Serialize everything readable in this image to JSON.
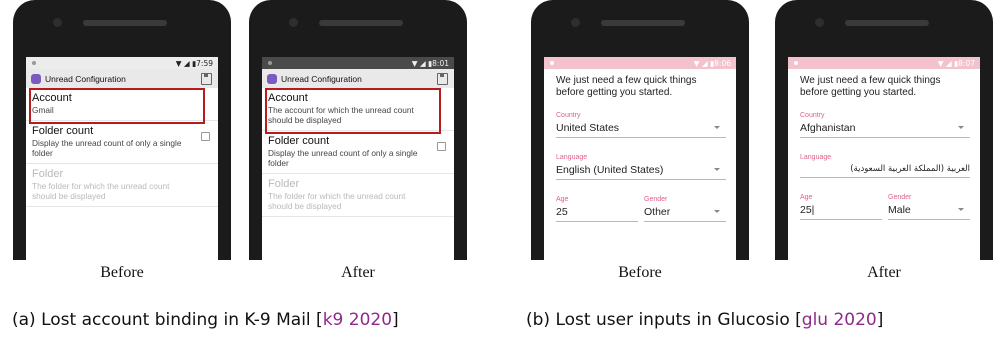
{
  "phones": [
    {
      "id": "k9-before",
      "status_time": "7:59",
      "app_title": "Unread Configuration",
      "items": [
        {
          "title": "Account",
          "subtitle": "Gmail",
          "disabled": false,
          "checkbox": false
        },
        {
          "title": "Folder count",
          "subtitle": "Display the unread count of only a single folder",
          "disabled": false,
          "checkbox": true
        },
        {
          "title": "Folder",
          "subtitle": "The folder for which the unread count should be displayed",
          "disabled": true,
          "checkbox": false
        }
      ],
      "caption": "Before"
    },
    {
      "id": "k9-after",
      "status_time": "8:01",
      "app_title": "Unread Configuration",
      "items": [
        {
          "title": "Account",
          "subtitle": "The account for which the unread count should be displayed",
          "disabled": false,
          "checkbox": false
        },
        {
          "title": "Folder count",
          "subtitle": "Display the unread count of only a single folder",
          "disabled": false,
          "checkbox": true
        },
        {
          "title": "Folder",
          "subtitle": "The folder for which the unread count should be displayed",
          "disabled": true,
          "checkbox": false
        }
      ],
      "caption": "After"
    },
    {
      "id": "glucosio-before",
      "status_time": "8:06",
      "intro": "We just need a few quick things before getting you started.",
      "country_label": "Country",
      "country_value": "United States",
      "language_label": "Language",
      "language_value": "English (United States)",
      "age_label": "Age",
      "age_value": "25",
      "gender_label": "Gender",
      "gender_value": "Other",
      "caption": "Before"
    },
    {
      "id": "glucosio-after",
      "status_time": "8:07",
      "intro": "We just need a few quick things before getting you started.",
      "country_label": "Country",
      "country_value": "Afghanistan",
      "language_label": "Language",
      "language_value": "العربية (المملكة العربية السعودية)",
      "age_label": "Age",
      "age_value": "25|",
      "gender_label": "Gender",
      "gender_value": "Male",
      "caption": "After"
    }
  ],
  "subcaptions": {
    "a_text": "(a) Lost account binding in K-9 Mail [",
    "a_cite": "k9 2020",
    "a_close": "]",
    "b_text": "(b) Lost user inputs in Glucosio [",
    "b_cite": "glu 2020",
    "b_close": "]"
  },
  "colors": {
    "highlight_box": "#b71c1c",
    "citation": "#8e2a8a",
    "glucosio_accent": "#e06287"
  }
}
